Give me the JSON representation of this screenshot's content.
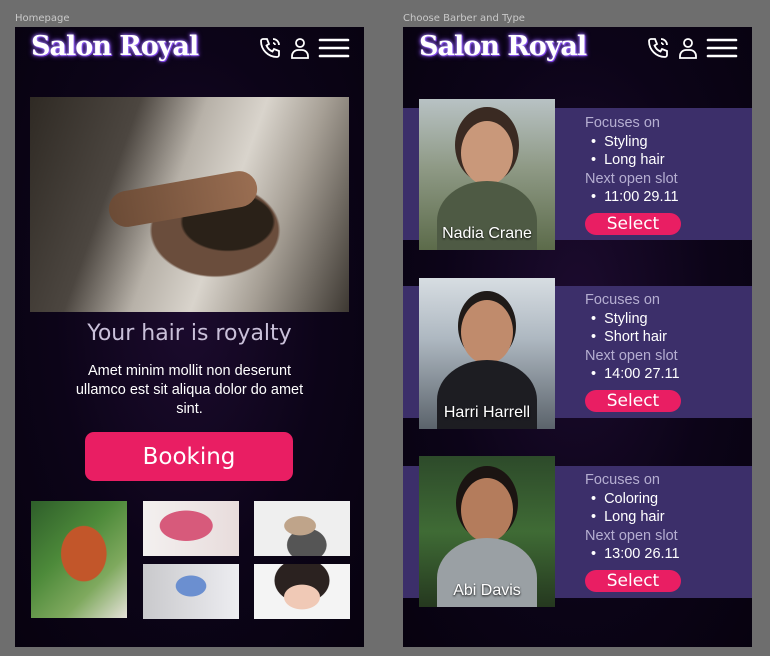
{
  "frames": {
    "home_label": "Homepage",
    "barbers_label": "Choose Barber and Type"
  },
  "brand": {
    "logo_text": "Salon Royal",
    "accent": "#e91e63",
    "panel": "#3c2f6a"
  },
  "header": {
    "icons": [
      "phone-icon",
      "user-icon",
      "menu-icon"
    ]
  },
  "home": {
    "tagline": "Your hair is royalty",
    "blurb": "Amet minim mollit non deserunt ullamco est sit aliqua dolor do amet sint.",
    "booking_label": "Booking"
  },
  "barbers": [
    {
      "name": "Nadia Crane",
      "focus_label": "Focuses on",
      "focus": [
        "Styling",
        "Long hair"
      ],
      "slot_label": "Next open slot",
      "slot": "11:00 29.11",
      "select_label": "Select"
    },
    {
      "name": "Harri Harrell",
      "focus_label": "Focuses on",
      "focus": [
        "Styling",
        "Short hair"
      ],
      "slot_label": "Next open slot",
      "slot": "14:00 27.11",
      "select_label": "Select"
    },
    {
      "name": "Abi Davis",
      "focus_label": "Focuses on",
      "focus": [
        "Coloring",
        "Long hair"
      ],
      "slot_label": "Next open slot",
      "slot": "13:00 26.11",
      "select_label": "Select"
    }
  ]
}
